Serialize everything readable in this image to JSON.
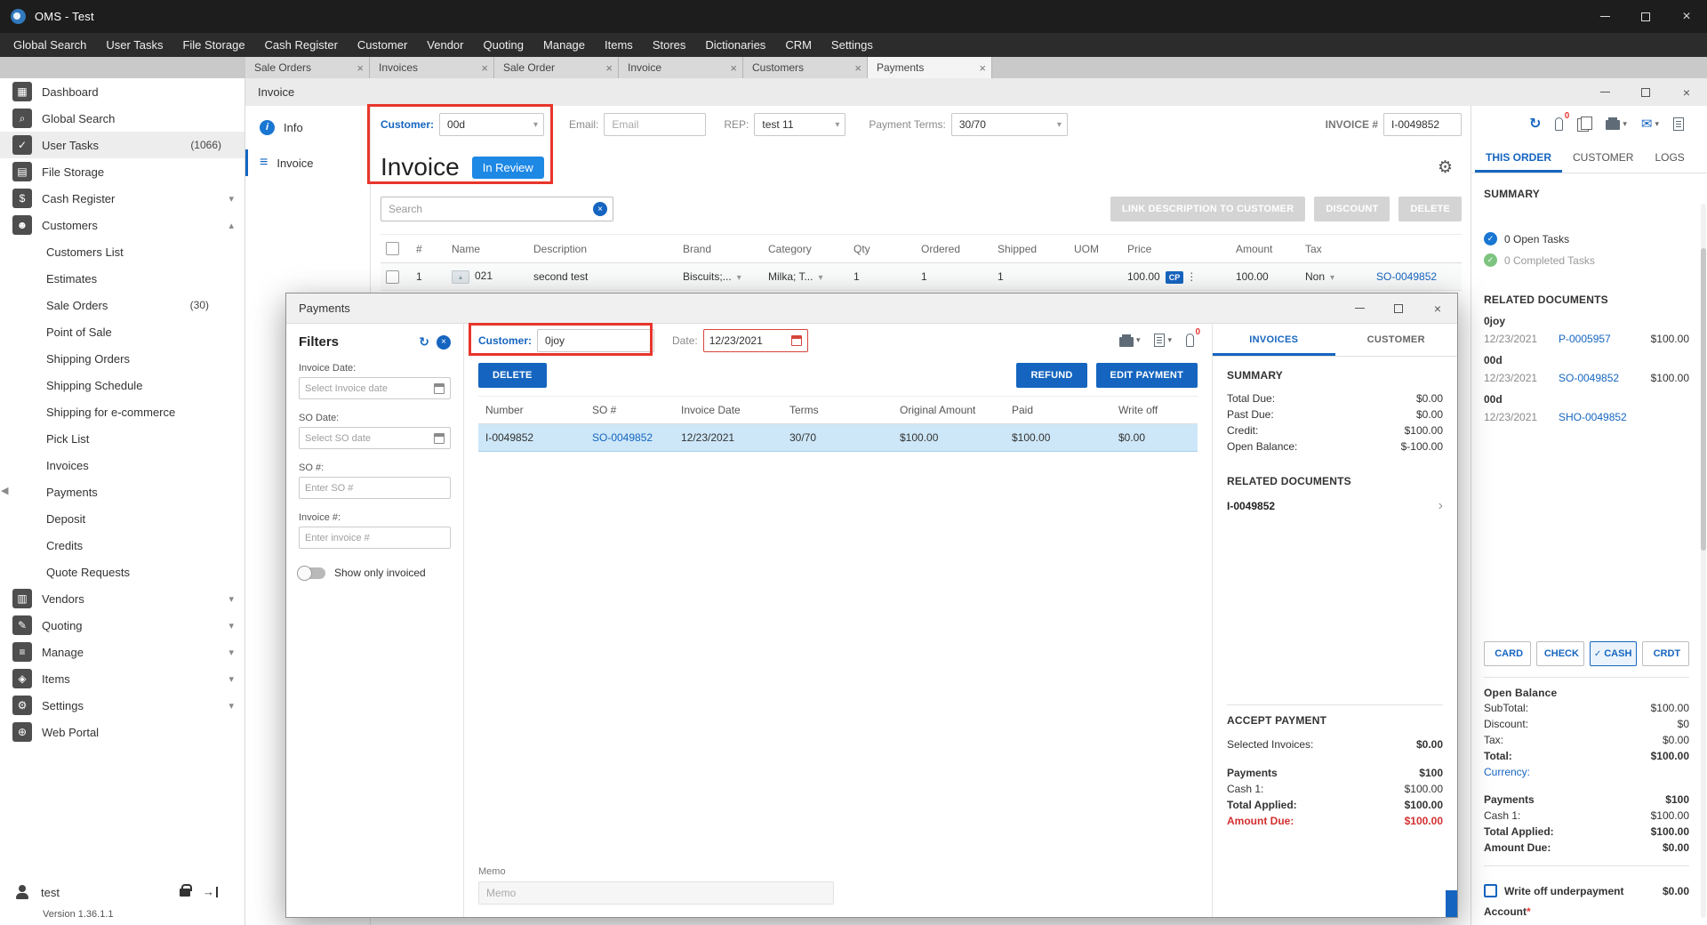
{
  "glyphs": {
    "caret": "▾",
    "chevron_up": "▴",
    "chevron_right": "›",
    "close": "×",
    "check": "✓",
    "kebab": "⋮",
    "refresh": "↻",
    "mail": "✉",
    "gear": "⚙",
    "back": "◀",
    "pic": "▴",
    "info": "i",
    "list": "≡",
    "arrow": "→"
  },
  "colors": {
    "accent": "#1565c0",
    "badge_blue": "#1e88e5",
    "annotation_red": "#e8352c",
    "due_red": "#d32f2f",
    "task_green": "#7cc47f"
  },
  "window": {
    "title": "OMS - Test"
  },
  "menubar": {
    "items": [
      {
        "label": "Global Search"
      },
      {
        "label": "User Tasks"
      },
      {
        "label": "File Storage"
      },
      {
        "label": "Cash Register"
      },
      {
        "label": "Customer"
      },
      {
        "label": "Vendor"
      },
      {
        "label": "Quoting"
      },
      {
        "label": "Manage"
      },
      {
        "label": "Items"
      },
      {
        "label": "Stores"
      },
      {
        "label": "Dictionaries"
      },
      {
        "label": "CRM"
      },
      {
        "label": "Settings"
      }
    ]
  },
  "tabbar": {
    "tabs": [
      {
        "label": "Sale Orders",
        "cls": "tab"
      },
      {
        "label": "Invoices",
        "cls": "tab"
      },
      {
        "label": "Sale Order",
        "cls": "tab"
      },
      {
        "label": "Invoice",
        "cls": "tab"
      },
      {
        "label": "Customers",
        "cls": "tab"
      },
      {
        "label": "Payments",
        "cls": "tab active"
      }
    ]
  },
  "sidebar": {
    "items": [
      {
        "label": "Dashboard",
        "glyph": "▦",
        "badge": "",
        "chevron": "",
        "cls": "srow"
      },
      {
        "label": "Global Search",
        "glyph": "⌕",
        "badge": "",
        "chevron": "",
        "cls": "srow"
      },
      {
        "label": "User Tasks",
        "glyph": "✓",
        "badge": "(1066)",
        "chevron": "",
        "cls": "srow hl"
      },
      {
        "label": "File Storage",
        "glyph": "▤",
        "badge": "",
        "chevron": "",
        "cls": "srow"
      },
      {
        "label": "Cash Register",
        "glyph": "$",
        "badge": "",
        "chevron": "▾",
        "cls": "srow"
      },
      {
        "label": "Customers",
        "glyph": "☻",
        "badge": "",
        "chevron": "▴",
        "cls": "srow"
      }
    ],
    "customer_children": [
      {
        "label": "Customers List",
        "badge": ""
      },
      {
        "label": "Estimates",
        "badge": ""
      },
      {
        "label": "Sale Orders",
        "badge": "(30)"
      },
      {
        "label": "Point of Sale",
        "badge": ""
      },
      {
        "label": "Shipping Orders",
        "badge": ""
      },
      {
        "label": "Shipping Schedule",
        "badge": ""
      },
      {
        "label": "Shipping for e-commerce",
        "badge": ""
      },
      {
        "label": "Pick List",
        "badge": ""
      },
      {
        "label": "Invoices",
        "badge": ""
      },
      {
        "label": "Payments",
        "badge": ""
      },
      {
        "label": "Deposit",
        "badge": ""
      },
      {
        "label": "Credits",
        "badge": ""
      },
      {
        "label": "Quote Requests",
        "badge": ""
      }
    ],
    "items_bottom": [
      {
        "label": "Vendors",
        "glyph": "▥",
        "badge": "",
        "chevron": "▾",
        "cls": "srow"
      },
      {
        "label": "Quoting",
        "glyph": "✎",
        "badge": "",
        "chevron": "▾",
        "cls": "srow"
      },
      {
        "label": "Manage",
        "glyph": "≡",
        "badge": "",
        "chevron": "▾",
        "cls": "srow"
      },
      {
        "label": "Items",
        "glyph": "◈",
        "badge": "",
        "chevron": "▾",
        "cls": "srow"
      },
      {
        "label": "Settings",
        "glyph": "⚙",
        "badge": "",
        "chevron": "▾",
        "cls": "srow"
      },
      {
        "label": "Web Portal",
        "glyph": "⊕",
        "badge": "",
        "chevron": "",
        "cls": "srow"
      }
    ],
    "user": "test",
    "version": "Version 1.36.1.1"
  },
  "invoice": {
    "window_title": "Invoice",
    "nav_info": "Info",
    "nav_invoice": "Invoice",
    "header": {
      "customer_label": "Customer:",
      "customer_value": "00d",
      "email_label": "Email:",
      "email_placeholder": "Email",
      "rep_label": "REP:",
      "rep_value": "test 11",
      "terms_label": "Payment Terms:",
      "terms_value": "30/70",
      "number_label": "INVOICE #",
      "number_value": "I-0049852"
    },
    "title": "Invoice",
    "status_badge": "In Review",
    "search_placeholder": "Search",
    "toolbar": [
      {
        "label": "LINK DESCRIPTION TO CUSTOMER"
      },
      {
        "label": "DISCOUNT"
      },
      {
        "label": "DELETE"
      }
    ],
    "columns": {
      "num": "#",
      "name": "Name",
      "description": "Description",
      "brand": "Brand",
      "category": "Category",
      "qty": "Qty",
      "ordered": "Ordered",
      "shipped": "Shipped",
      "uom": "UOM",
      "price": "Price",
      "amount": "Amount",
      "tax": "Tax",
      "so": ""
    },
    "row": {
      "num": "1",
      "name": "021",
      "description": "second test",
      "brand": "Biscuits;...",
      "category": "Milka; T...",
      "qty": "1",
      "ordered": "1",
      "shipped": "1",
      "uom": "",
      "price": "100.00",
      "price_badge": "CP",
      "amount": "100.00",
      "tax": "Non",
      "so_link": "SO-0049852"
    }
  },
  "panel": {
    "attach_count": "0",
    "tabs": [
      {
        "label": "THIS ORDER",
        "cls": "ptab active"
      },
      {
        "label": "CUSTOMER",
        "cls": "ptab"
      },
      {
        "label": "LOGS",
        "cls": "ptab"
      }
    ],
    "summary_heading": "SUMMARY",
    "open_tasks": "0 Open Tasks",
    "completed_tasks": "0 Completed Tasks",
    "related_heading": "RELATED DOCUMENTS",
    "related": [
      {
        "group": "0joy",
        "date": "12/23/2021",
        "doc": "P-0005957",
        "amount": "$100.00"
      },
      {
        "group": "00d",
        "date": "12/23/2021",
        "doc": "SO-0049852",
        "amount": "$100.00"
      },
      {
        "group": "00d",
        "date": "12/23/2021",
        "doc": "SHO-0049852",
        "amount": ""
      }
    ],
    "pay_methods": [
      {
        "label": "CARD",
        "check": "",
        "cls": "pm"
      },
      {
        "label": "CHECK",
        "check": "",
        "cls": "pm"
      },
      {
        "label": "CASH",
        "check": "✓",
        "cls": "pm active"
      },
      {
        "label": "CRDT",
        "check": "",
        "cls": "pm"
      }
    ],
    "balance_heading": "Open Balance",
    "subtotal_label": "SubTotal:",
    "subtotal": "$100.00",
    "discount_label": "Discount:",
    "discount": "$0",
    "tax_label": "Tax:",
    "tax": "$0.00",
    "total_label": "Total:",
    "total": "$100.00",
    "currency_label": "Currency:",
    "payments_label": "Payments",
    "payments_value": "$100",
    "cash_label": "Cash 1:",
    "cash_value": "$100.00",
    "applied_label": "Total Applied:",
    "applied_value": "$100.00",
    "due_label": "Amount Due:",
    "due_value": "$0.00",
    "writeoff_label": "Write off underpayment",
    "writeoff_value": "$0.00",
    "account_label": "Account",
    "account_required": "*"
  },
  "payments": {
    "window_title": "Payments",
    "filters": {
      "heading": "Filters",
      "invoice_date_label": "Invoice Date:",
      "invoice_date_placeholder": "Select Invoice date",
      "so_date_label": "SO Date:",
      "so_date_placeholder": "Select SO date",
      "so_number_label": "SO #:",
      "so_number_placeholder": "Enter SO #",
      "invoice_number_label": "Invoice #:",
      "invoice_number_placeholder": "Enter invoice #",
      "toggle_label": "Show only invoiced"
    },
    "header": {
      "customer_label": "Customer:",
      "customer_value": "0joy",
      "date_label": "Date:",
      "date_value": "12/23/2021",
      "attach_count": "0"
    },
    "delete_button": "DELETE",
    "refund_button": "REFUND",
    "edit_payment_button": "EDIT PAYMENT",
    "columns": {
      "number": "Number",
      "so": "SO #",
      "invoice_date": "Invoice Date",
      "terms": "Terms",
      "original_amount": "Original Amount",
      "paid": "Paid",
      "write_off": "Write off"
    },
    "row": {
      "number": "I-0049852",
      "so": "SO-0049852",
      "invoice_date": "12/23/2021",
      "terms": "30/70",
      "original_amount": "$100.00",
      "paid": "$100.00",
      "write_off": "$0.00"
    },
    "memo_label": "Memo",
    "memo_placeholder": "Memo",
    "side": {
      "tabs": [
        {
          "label": "INVOICES",
          "cls": "mtab active"
        },
        {
          "label": "CUSTOMER",
          "cls": "mtab"
        }
      ],
      "summary_heading": "SUMMARY",
      "total_due_label": "Total Due:",
      "total_due": "$0.00",
      "past_due_label": "Past Due:",
      "past_due": "$0.00",
      "credit_label": "Credit:",
      "credit": "$100.00",
      "open_balance_label": "Open Balance:",
      "open_balance": "$-100.00",
      "related_heading": "RELATED DOCUMENTS",
      "related_doc": "I-0049852",
      "accept_heading": "ACCEPT PAYMENT",
      "selected_label": "Selected Invoices:",
      "selected_value": "$0.00",
      "payments_label": "Payments",
      "payments_value": "$100",
      "cash_label": "Cash 1:",
      "cash_value": "$100.00",
      "applied_label": "Total Applied:",
      "applied_value": "$100.00",
      "due_label": "Amount Due:",
      "due_value": "$100.00"
    }
  }
}
